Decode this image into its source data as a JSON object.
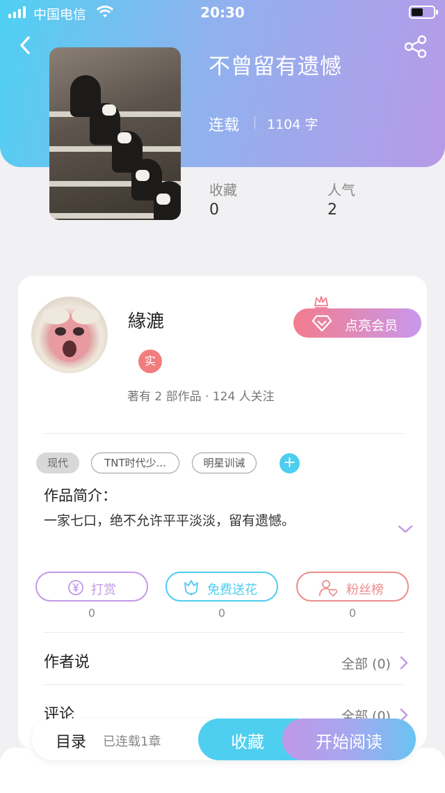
{
  "status_bar": {
    "carrier": "中国电信",
    "time": "20:30"
  },
  "book": {
    "title": "不曾留有遗憾",
    "status": "连载",
    "word_count": "1104 字",
    "stats": [
      {
        "label": "收藏",
        "value": "0"
      },
      {
        "label": "人气",
        "value": "2"
      }
    ]
  },
  "author": {
    "name": "緣漉",
    "badge": "实",
    "meta": "著有 2 部作品 · 124 人关注",
    "vip_label": "点亮会员"
  },
  "tags": [
    "现代",
    "TNT时代少...",
    "明星训诫"
  ],
  "intro": {
    "title": "作品简介：",
    "text": "一家七口，绝不允许平平淡淡，留有遗憾。"
  },
  "actions": [
    {
      "label": "打赏",
      "count": "0",
      "color": "#c299e6",
      "icon": "yen-icon"
    },
    {
      "label": "免费送花",
      "count": "0",
      "color": "#4dcdf0",
      "icon": "flower-icon"
    },
    {
      "label": "粉丝榜",
      "count": "0",
      "color": "#ec8d8a",
      "icon": "fans-icon"
    }
  ],
  "sections": [
    {
      "title": "作者说",
      "right": "全部 (0)"
    },
    {
      "title": "评论",
      "right": "全部 (0)"
    }
  ],
  "bottom_bar": {
    "toc": "目录",
    "chapters": "已连载1章",
    "favorite": "收藏",
    "read": "开始阅读"
  },
  "colors": {
    "header_gradient_start": "#4fd0f2",
    "header_gradient_end": "#b79ae8",
    "accent_blue": "#4fcff0",
    "accent_purple": "#c299e6"
  }
}
